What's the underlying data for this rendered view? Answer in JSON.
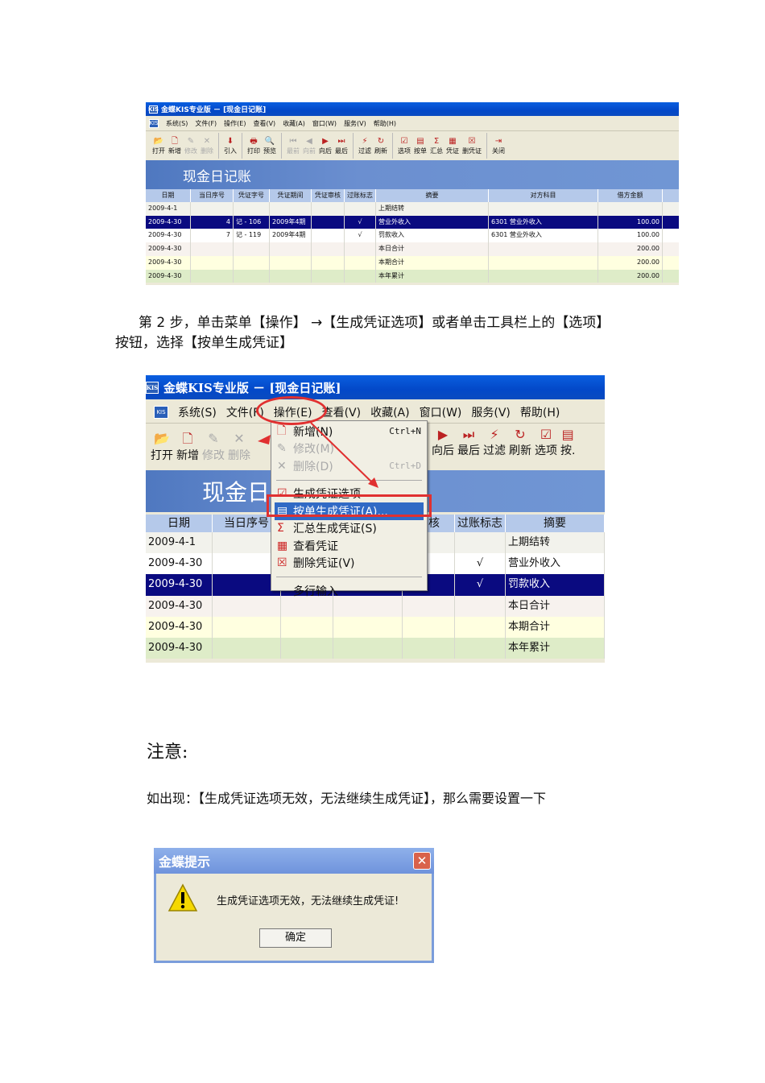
{
  "shot1": {
    "title": "金蝶KIS专业版 － [现金日记账]",
    "menu": [
      "系统(S)",
      "文件(F)",
      "操作(E)",
      "查看(V)",
      "收藏(A)",
      "窗口(W)",
      "服务(V)",
      "帮助(H)"
    ],
    "toolbar": [
      {
        "label": "打开",
        "icon": "📂",
        "dis": false
      },
      {
        "label": "新增",
        "icon": "🗋",
        "dis": false
      },
      {
        "label": "修改",
        "icon": "✎",
        "dis": true
      },
      {
        "label": "删除",
        "icon": "✕",
        "dis": true
      },
      {
        "label": "引入",
        "icon": "⬇",
        "dis": false
      },
      {
        "label": "打印",
        "icon": "🖶",
        "dis": false
      },
      {
        "label": "预览",
        "icon": "🔍",
        "dis": false
      },
      {
        "label": "最前",
        "icon": "⏮",
        "dis": true
      },
      {
        "label": "向前",
        "icon": "◀",
        "dis": true
      },
      {
        "label": "向后",
        "icon": "▶",
        "dis": false
      },
      {
        "label": "最后",
        "icon": "⏭",
        "dis": false
      },
      {
        "label": "过滤",
        "icon": "⚡",
        "dis": false
      },
      {
        "label": "刷新",
        "icon": "↻",
        "dis": false
      },
      {
        "label": "选项",
        "icon": "☑",
        "dis": false
      },
      {
        "label": "按单",
        "icon": "▤",
        "dis": false
      },
      {
        "label": "汇总",
        "icon": "Σ",
        "dis": false
      },
      {
        "label": "凭证",
        "icon": "▦",
        "dis": false
      },
      {
        "label": "删凭证",
        "icon": "☒",
        "dis": false
      },
      {
        "label": "关闭",
        "icon": "⇥",
        "dis": false
      }
    ],
    "banner": "现金日记账",
    "columns": [
      "日期",
      "当日序号",
      "凭证字号",
      "凭证期间",
      "凭证审核",
      "过账标志",
      "摘要",
      "对方科目",
      "借方金额"
    ],
    "rows": [
      [
        "2009-4-1",
        "",
        "",
        "",
        "",
        "",
        "上期结转",
        "",
        ""
      ],
      [
        "2009-4-30",
        "4",
        "记 - 106",
        "2009年4期",
        "",
        "√",
        "营业外收入",
        "6301 营业外收入",
        "100.00"
      ],
      [
        "2009-4-30",
        "7",
        "记 - 119",
        "2009年4期",
        "",
        "√",
        "罚款收入",
        "6301 营业外收入",
        "100.00"
      ],
      [
        "2009-4-30",
        "",
        "",
        "",
        "",
        "",
        "本日合计",
        "",
        "200.00"
      ],
      [
        "2009-4-30",
        "",
        "",
        "",
        "",
        "",
        "本期合计",
        "",
        "200.00"
      ],
      [
        "2009-4-30",
        "",
        "",
        "",
        "",
        "",
        "本年累计",
        "",
        "200.00"
      ]
    ]
  },
  "step2_line1": "第 2 步，单击菜单【操作】 →【生成凭证选项】或者单击工具栏上的【选项】",
  "step2_line2": "按钮，选择【按单生成凭证】",
  "shot2": {
    "title": "金蝶KIS专业版 － [现金日记账]",
    "menu": [
      "系统(S)",
      "文件(F)",
      "操作(E)",
      "查看(V)",
      "收藏(A)",
      "窗口(W)",
      "服务(V)",
      "帮助(H)"
    ],
    "toolbar_left": [
      {
        "label": "打开",
        "icon": "📂",
        "dis": false
      },
      {
        "label": "新增",
        "icon": "🗋",
        "dis": false
      },
      {
        "label": "修改",
        "icon": "✎",
        "dis": true
      },
      {
        "label": "删除",
        "icon": "✕",
        "dis": true
      }
    ],
    "toolbar_right": [
      {
        "label": "向后",
        "icon": "▶",
        "dis": false
      },
      {
        "label": "最后",
        "icon": "⏭",
        "dis": false
      },
      {
        "label": "过滤",
        "icon": "⚡",
        "dis": false
      },
      {
        "label": "刷新",
        "icon": "↻",
        "dis": false
      },
      {
        "label": "选项",
        "icon": "☑",
        "dis": false
      },
      {
        "label": "按.",
        "icon": "▤",
        "dis": false
      }
    ],
    "banner": "现金日",
    "columns": [
      "日期",
      "当日序号",
      "",
      "",
      "审核",
      "过账标志",
      "摘要"
    ],
    "rows": [
      [
        "2009-4-1",
        "",
        "",
        "",
        "",
        "",
        "上期结转"
      ],
      [
        "2009-4-30",
        "",
        "",
        "",
        "",
        "√",
        "营业外收入"
      ],
      [
        "2009-4-30",
        "",
        "",
        "",
        "",
        "√",
        "罚款收入"
      ],
      [
        "2009-4-30",
        "",
        "",
        "",
        "",
        "",
        "本日合计"
      ],
      [
        "2009-4-30",
        "",
        "",
        "",
        "",
        "",
        "本期合计"
      ],
      [
        "2009-4-30",
        "",
        "",
        "",
        "",
        "",
        "本年累计"
      ]
    ],
    "dropdown": [
      {
        "label": "新增(N)",
        "shortcut": "Ctrl+N",
        "icon": "🗋",
        "dis": false
      },
      {
        "label": "修改(M)",
        "shortcut": "",
        "icon": "✎",
        "dis": true
      },
      {
        "label": "删除(D)",
        "shortcut": "Ctrl+D",
        "icon": "✕",
        "dis": true
      },
      {
        "sep": true
      },
      {
        "label": "生成凭证选项",
        "shortcut": "",
        "icon": "☑",
        "dis": false
      },
      {
        "label": "按单生成凭证(A)...",
        "shortcut": "",
        "icon": "▤",
        "dis": false,
        "hl": true
      },
      {
        "label": "汇总生成凭证(S)",
        "shortcut": "",
        "icon": "Σ",
        "dis": false
      },
      {
        "label": "查看凭证",
        "shortcut": "",
        "icon": "▦",
        "dis": false
      },
      {
        "label": "删除凭证(V)",
        "shortcut": "",
        "icon": "☒",
        "dis": false
      },
      {
        "sep": true
      },
      {
        "label": "多行输入",
        "shortcut": "",
        "icon": "",
        "dis": false
      }
    ]
  },
  "note_title": "注意:",
  "note_text": "如出现：【生成凭证选项无效，无法继续生成凭证】，那么需要设置一下",
  "dialog": {
    "title": "金蝶提示",
    "message": "生成凭证选项无效，无法继续生成凭证!",
    "ok": "确定",
    "close": "✕"
  },
  "colors": {
    "accent_red": "#e03030",
    "title_blue": "#0348c8",
    "selected_row": "#0a0a80"
  }
}
